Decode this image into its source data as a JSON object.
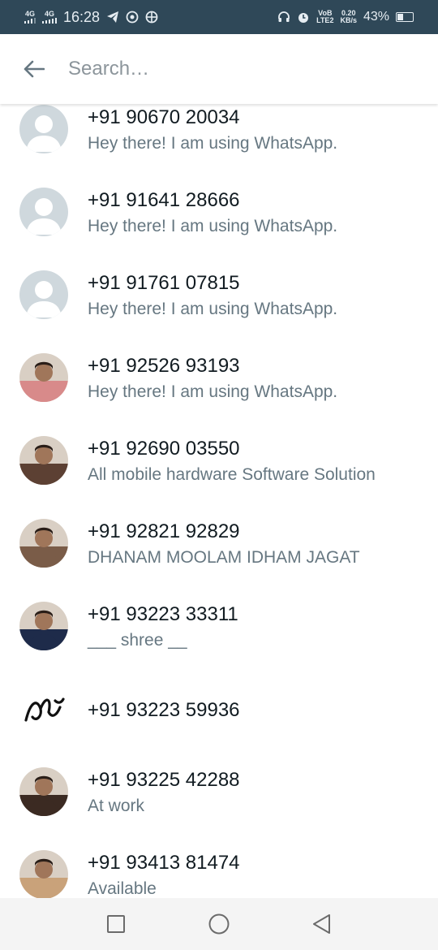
{
  "status_bar": {
    "net1": "4G",
    "net2": "4G",
    "time": "16:28",
    "volte_top": "VoB",
    "volte_bottom": "LTE2",
    "speed_top": "0.20",
    "speed_bottom": "KB/s",
    "battery": "43%",
    "battery_level": 0.43,
    "icons": [
      "signal-icon",
      "telegram-icon",
      "whatsapp-icon",
      "globe-icon",
      "headphones-icon",
      "alarm-icon",
      "battery-icon"
    ]
  },
  "search": {
    "placeholder": "Search…",
    "back_icon": "arrow-left-icon"
  },
  "contacts": [
    {
      "name": "+91 90670 20034",
      "about": "Hey there! I am using WhatsApp.",
      "avatar": "default-avatar"
    },
    {
      "name": "+91 91641 28666",
      "about": "Hey there! I am using WhatsApp.",
      "avatar": "default-avatar"
    },
    {
      "name": "+91 91761 07815",
      "about": "Hey there! I am using WhatsApp.",
      "avatar": "default-avatar"
    },
    {
      "name": "+91 92526 93193",
      "about": "Hey there! I am using WhatsApp.",
      "avatar": "photo"
    },
    {
      "name": "+91 92690 03550",
      "about": "All mobile hardware Software Solution",
      "avatar": "photo"
    },
    {
      "name": "+91 92821 92829",
      "about": "DHANAM MOOLAM IDHAM JAGAT",
      "avatar": "photo"
    },
    {
      "name": "+91 93223 33311",
      "about": "___ shree __",
      "avatar": "photo"
    },
    {
      "name": "+91 93223 59936",
      "about": "",
      "avatar": "logo"
    },
    {
      "name": "+91 93225 42288",
      "about": "At work",
      "avatar": "photo"
    },
    {
      "name": "+91 93413 81474",
      "about": "Available",
      "avatar": "photo"
    }
  ],
  "nav": {
    "recents_icon": "square-icon",
    "home_icon": "circle-icon",
    "back_icon": "triangle-back-icon"
  },
  "colors": {
    "status_bar_bg": "#2f4858",
    "name_text": "#111b21",
    "about_text": "#667781",
    "default_avatar_bg": "#cfd8dd"
  }
}
